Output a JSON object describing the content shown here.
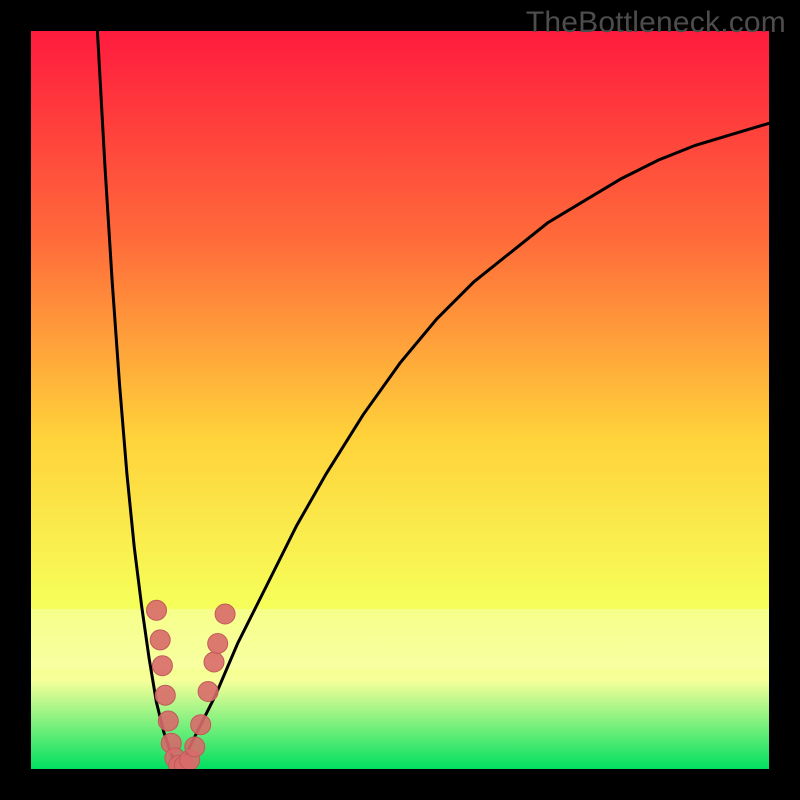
{
  "watermark": "TheBottleneck.com",
  "colors": {
    "frame": "#000000",
    "gradient_top": "#ff1b3e",
    "gradient_mid_upper": "#ff6a3a",
    "gradient_mid": "#ffd23a",
    "gradient_lower": "#f6ff5a",
    "gradient_bottom_band": "#f6ff9a",
    "gradient_bottom": "#00e060",
    "curve": "#000000",
    "dot_fill": "#d86a6a",
    "dot_stroke": "#c05a5a"
  },
  "chart_data": {
    "type": "line",
    "title": "",
    "xlabel": "",
    "ylabel": "",
    "xlim": [
      0,
      100
    ],
    "ylim": [
      0,
      100
    ],
    "notch_x": 20,
    "curve_left": {
      "x": [
        9,
        10,
        11,
        12,
        13,
        14,
        15,
        16,
        17,
        18,
        19,
        20
      ],
      "y": [
        100,
        82,
        66,
        52,
        40,
        30,
        22,
        15,
        9,
        5,
        2,
        0
      ]
    },
    "curve_right": {
      "x": [
        20,
        22,
        25,
        28,
        32,
        36,
        40,
        45,
        50,
        55,
        60,
        65,
        70,
        75,
        80,
        85,
        90,
        95,
        100
      ],
      "y": [
        0,
        4,
        10,
        17,
        25,
        33,
        40,
        48,
        55,
        61,
        66,
        70,
        74,
        77,
        80,
        82.5,
        84.5,
        86,
        87.5
      ]
    },
    "dots": [
      {
        "x": 17.0,
        "y": 21.5
      },
      {
        "x": 17.5,
        "y": 17.5
      },
      {
        "x": 17.8,
        "y": 14.0
      },
      {
        "x": 18.2,
        "y": 10.0
      },
      {
        "x": 18.6,
        "y": 6.5
      },
      {
        "x": 19.0,
        "y": 3.5
      },
      {
        "x": 19.5,
        "y": 1.5
      },
      {
        "x": 20.0,
        "y": 0.5
      },
      {
        "x": 20.8,
        "y": 0.5
      },
      {
        "x": 21.5,
        "y": 1.2
      },
      {
        "x": 22.2,
        "y": 3.0
      },
      {
        "x": 23.0,
        "y": 6.0
      },
      {
        "x": 24.0,
        "y": 10.5
      },
      {
        "x": 24.8,
        "y": 14.5
      },
      {
        "x": 25.3,
        "y": 17.0
      },
      {
        "x": 26.3,
        "y": 21.0
      }
    ]
  }
}
